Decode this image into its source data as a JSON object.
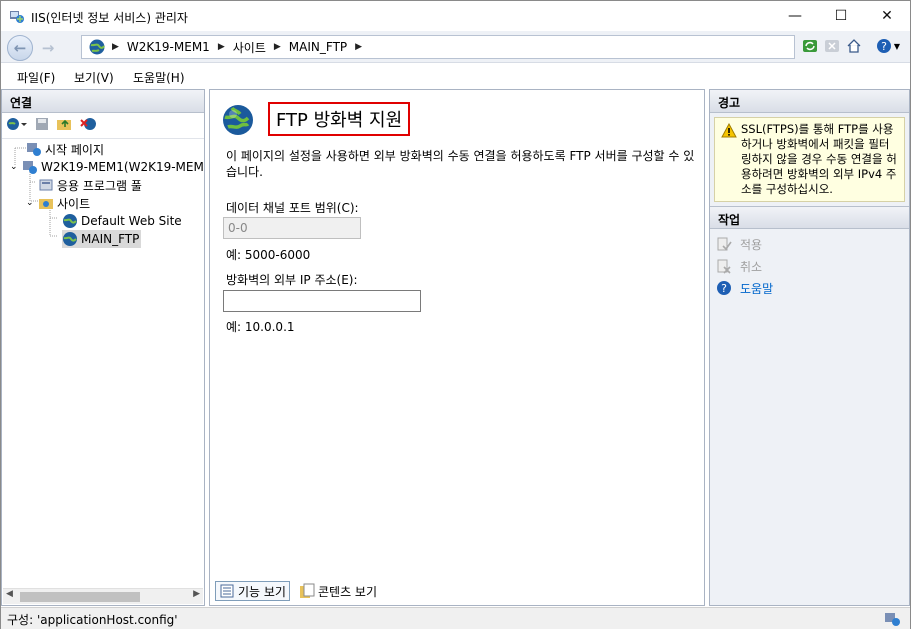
{
  "window": {
    "title": "IIS(인터넷 정보 서비스) 관리자",
    "minimize": "—",
    "maximize": "☐",
    "close": "✕"
  },
  "navbar": {
    "breadcrumbs": [
      "W2K19-MEM1",
      "사이트",
      "MAIN_FTP"
    ],
    "icons": [
      "refresh-icon",
      "stop-icon",
      "home-icon",
      "help-icon"
    ]
  },
  "menu": {
    "items": [
      "파일(F)",
      "보기(V)",
      "도움말(H)"
    ]
  },
  "connections": {
    "header": "연결",
    "tree": [
      {
        "label": "시작 페이지",
        "icon": "start-page-icon"
      },
      {
        "label": "W2K19-MEM1(W2K19-MEM",
        "icon": "server-icon"
      },
      {
        "label": "응용 프로그램 풀",
        "icon": "app-pool-icon"
      },
      {
        "label": "사이트",
        "icon": "sites-folder-icon"
      },
      {
        "label": "Default Web Site",
        "icon": "globe-icon"
      },
      {
        "label": "MAIN_FTP",
        "icon": "globe-icon"
      }
    ]
  },
  "feature": {
    "title": "FTP 방화벽 지원",
    "description": "이 페이지의 설정을 사용하면 외부 방화벽의 수동 연결을 허용하도록 FTP 서버를 구성할 수 있습니다.",
    "port_label": "데이터 채널 포트 범위(C):",
    "port_value": "0-0",
    "port_example": "예: 5000-6000",
    "ip_label": "방화벽의 외부 IP 주소(E):",
    "ip_value": "",
    "ip_example": "예: 10.0.0.1"
  },
  "view_tabs": {
    "features": "기능 보기",
    "content": "콘텐츠 보기"
  },
  "alerts": {
    "header": "경고",
    "message": "SSL(FTPS)를 통해 FTP를 사용하거나 방화벽에서 패킷을 필터링하지 않을 경우 수동 연결을 허용하려면 방화벽의 외부 IPv4 주소를 구성하십시오."
  },
  "actions": {
    "header": "작업",
    "apply": "적용",
    "cancel": "취소",
    "help": "도움말"
  },
  "status": {
    "text": "구성: 'applicationHost.config'"
  },
  "colors": {
    "accent": "#0066cc",
    "alert_bg": "#ffffe1",
    "highlight_border": "#e00000"
  }
}
